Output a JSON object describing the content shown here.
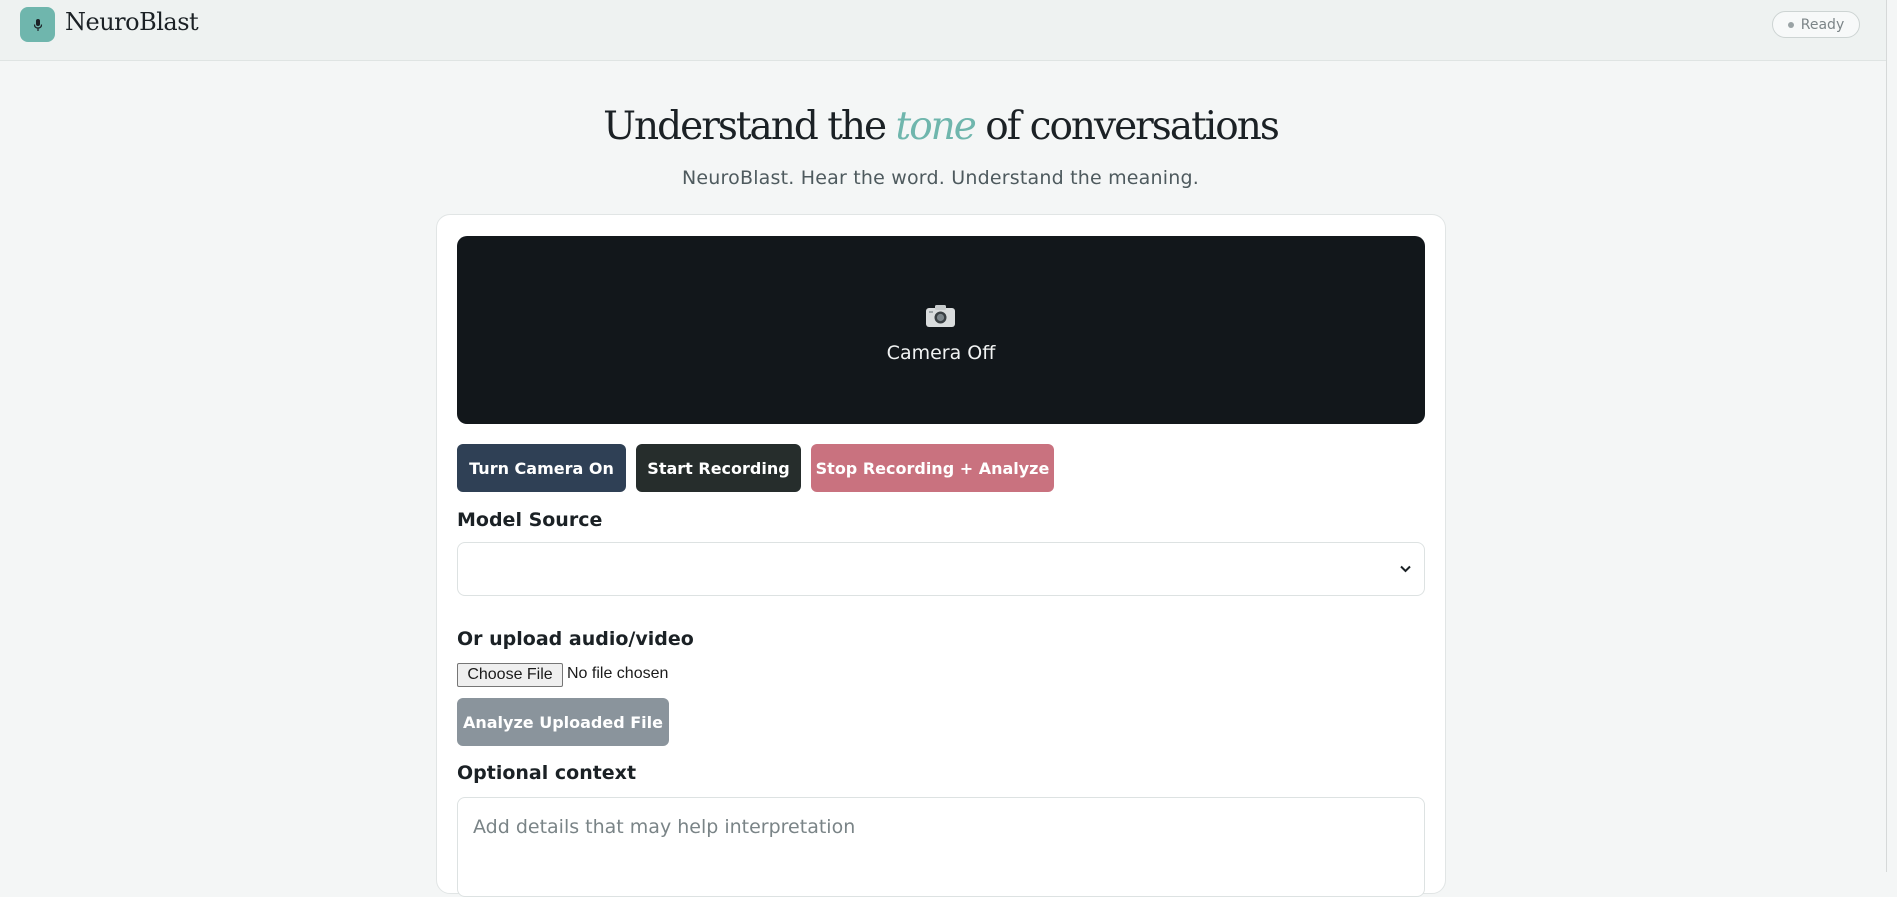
{
  "header": {
    "brand": "NeuroBlast",
    "logo_icon": "microphone-icon",
    "status": "Ready",
    "accent_color": "#6fb6ad"
  },
  "hero": {
    "title_before": "Understand the",
    "title_accent": "tone",
    "title_after": "of conversations",
    "subtitle": "NeuroBlast. Hear the word. Understand the meaning."
  },
  "camera": {
    "icon": "camera-icon",
    "label": "Camera Off",
    "buttons": {
      "camera_on": "Turn Camera On",
      "start_recording": "Start Recording",
      "stop_analyze": "Stop Recording + Analyze"
    }
  },
  "model_source": {
    "label": "Model Source",
    "selected": ""
  },
  "upload": {
    "label": "Or upload audio/video",
    "choose_file": "Choose File",
    "file_status": "No file chosen",
    "analyze_button": "Analyze Uploaded File"
  },
  "context": {
    "label": "Optional context",
    "placeholder": "Add details that may help interpretation"
  }
}
